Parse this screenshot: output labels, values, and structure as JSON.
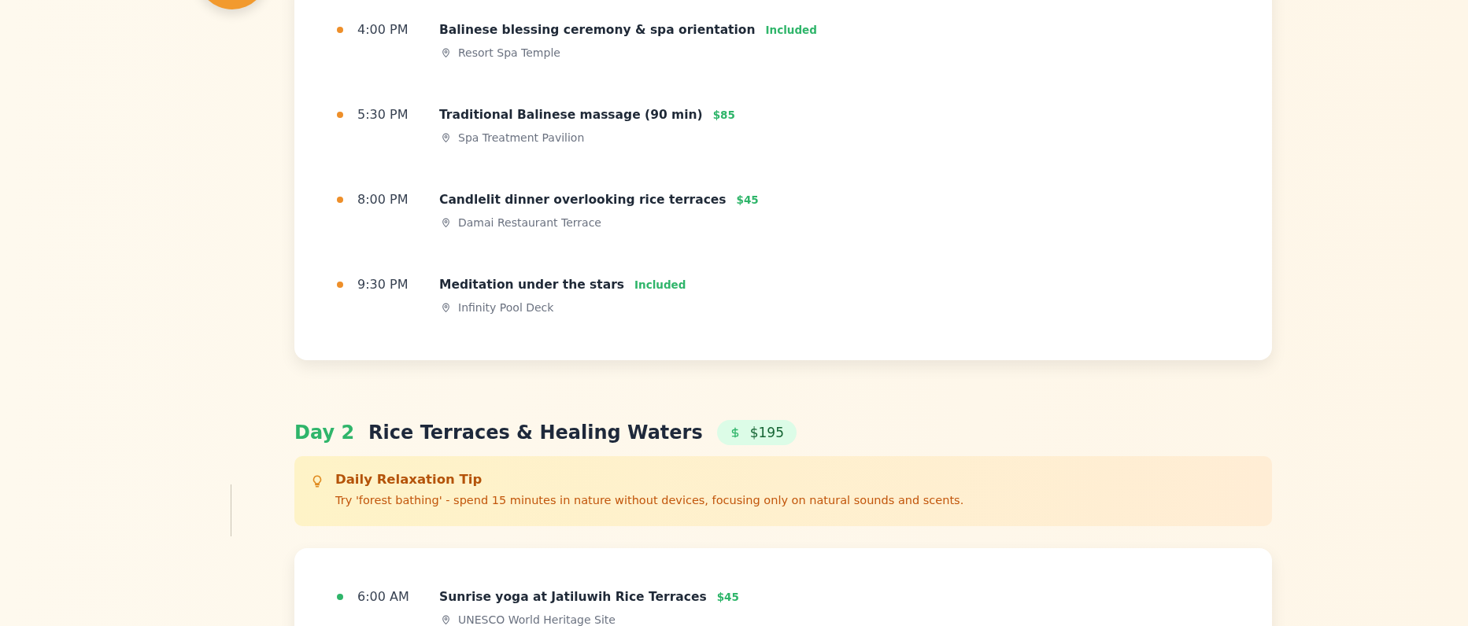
{
  "days": [
    {
      "color": "#ee8f2a",
      "activities": [
        {
          "time": "4:00 PM",
          "title": "Balinese blessing ceremony & spa orientation",
          "price": "Included",
          "location": "Resort Spa Temple"
        },
        {
          "time": "5:30 PM",
          "title": "Traditional Balinese massage (90 min)",
          "price": "$85",
          "location": "Spa Treatment Pavilion"
        },
        {
          "time": "8:00 PM",
          "title": "Candlelit dinner overlooking rice terraces",
          "price": "$45",
          "location": "Damai Restaurant Terrace"
        },
        {
          "time": "9:30 PM",
          "title": "Meditation under the stars",
          "price": "Included",
          "location": "Infinity Pool Deck"
        }
      ]
    },
    {
      "label": "Day 2",
      "title": "Rice Terraces & Healing Waters",
      "cost": "$195",
      "tip": {
        "title": "Daily Relaxation Tip",
        "text": "Try 'forest bathing' - spend 15 minutes in nature without devices, focusing only on natural sounds and scents."
      },
      "color": "#2fb56a",
      "activities": [
        {
          "time": "6:00 AM",
          "title": "Sunrise yoga at Jatiluwih Rice Terraces",
          "price": "$45",
          "location": "UNESCO World Heritage Site"
        }
      ]
    }
  ]
}
